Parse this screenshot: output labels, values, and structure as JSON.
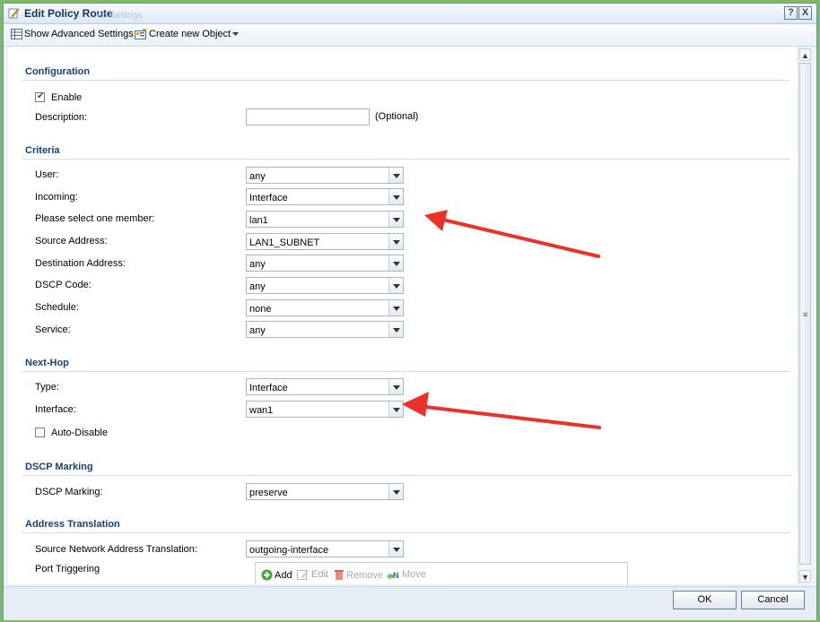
{
  "window": {
    "title": "Edit Policy Route",
    "ghost_title": "...ed Settings",
    "help_icon": "?",
    "close_icon": "X"
  },
  "toolbar": {
    "advanced_label": "Show Advanced Settings",
    "create_label": "Create new Object"
  },
  "configuration": {
    "heading": "Configuration",
    "enable_label": "Enable",
    "enable_checked": true,
    "description_label": "Description:",
    "description_value": "",
    "optional_hint": "(Optional)"
  },
  "criteria": {
    "heading": "Criteria",
    "fields": [
      {
        "label": "User:",
        "value": "any"
      },
      {
        "label": "Incoming:",
        "value": "Interface"
      },
      {
        "label": "Please select one member:",
        "value": "lan1"
      },
      {
        "label": "Source Address:",
        "value": "LAN1_SUBNET"
      },
      {
        "label": "Destination Address:",
        "value": "any"
      },
      {
        "label": "DSCP Code:",
        "value": "any"
      },
      {
        "label": "Schedule:",
        "value": "none"
      },
      {
        "label": "Service:",
        "value": "any"
      }
    ]
  },
  "nexthop": {
    "heading": "Next-Hop",
    "type_label": "Type:",
    "type_value": "Interface",
    "interface_label": "Interface:",
    "interface_value": "wan1",
    "autodisable_label": "Auto-Disable",
    "autodisable_checked": false
  },
  "dscp": {
    "heading": "DSCP Marking",
    "label": "DSCP Marking:",
    "value": "preserve"
  },
  "address_translation": {
    "heading": "Address Translation",
    "snat_label": "Source Network Address Translation:",
    "snat_value": "outgoing-interface",
    "port_triggering_label": "Port Triggering",
    "pt_add": "Add",
    "pt_edit": "Edit",
    "pt_remove": "Remove",
    "pt_move": "Move"
  },
  "footer": {
    "ok_label": "OK",
    "cancel_label": "Cancel"
  },
  "colors": {
    "arrow": "#e8322a",
    "section_heading": "#15407a",
    "background": "#7fb86a"
  }
}
